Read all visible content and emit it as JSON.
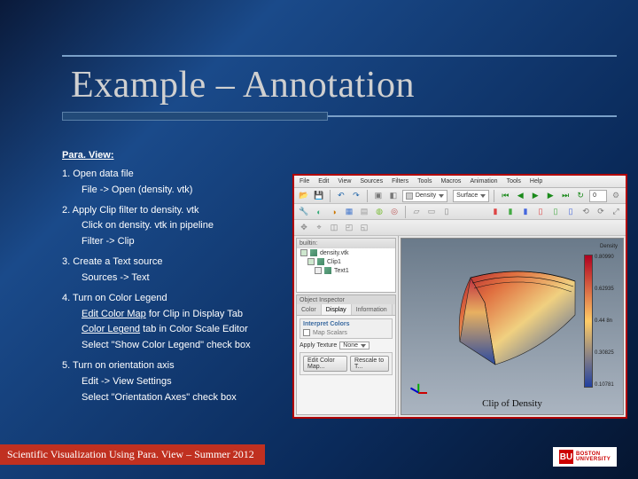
{
  "title": "Example – Annotation",
  "section_head": "Para. View:",
  "steps": [
    {
      "line": "1. Open data file",
      "subs": [
        "File -> Open (density. vtk)"
      ]
    },
    {
      "line": "2. Apply Clip filter to density. vtk",
      "subs": [
        "Click on density. vtk in pipeline",
        "Filter -> Clip"
      ]
    },
    {
      "line": "3. Create a Text source",
      "subs": [
        "Sources -> Text"
      ]
    },
    {
      "line": "4. Turn on Color Legend",
      "subs": [
        {
          "pre": "",
          "u": "Edit Color Map",
          "post": " for Clip in Display Tab"
        },
        {
          "pre": "",
          "u": "Color Legend",
          "post": " tab in Color Scale Editor"
        },
        "Select \"Show Color Legend\" check box"
      ]
    },
    {
      "line": "5. Turn on orientation axis",
      "subs": [
        "Edit -> View Settings",
        "Select \"Orientation Axes\" check box"
      ]
    }
  ],
  "footer": "Scientific Visualization Using Para. View – Summer 2012",
  "logo": {
    "initials": "BU",
    "line1": "BOSTON",
    "line2": "UNIVERSITY"
  },
  "paraview": {
    "menu": [
      "File",
      "Edit",
      "View",
      "Sources",
      "Filters",
      "Tools",
      "Macros",
      "Animation",
      "Tools",
      "Help"
    ],
    "combo_left": "Density",
    "combo_right": "Surface",
    "pipeline_header": "builtin:",
    "pipeline_items": [
      "density.vtk",
      "Clip1",
      "Text1"
    ],
    "inspector_title": "Object Inspector",
    "tabs": [
      "Color",
      "Display",
      "Information"
    ],
    "grp1_title": "Interpret Colors",
    "grp1_check": "Map Scalars",
    "apply_texture_label": "Apply Texture",
    "apply_texture_value": "None",
    "btn_edit": "Edit Color Map...",
    "btn_rescale": "Rescale to T...",
    "legend_title": "Density",
    "legend_ticks": [
      "0.80990",
      "0.62935",
      "0.44 8n",
      "0.30825",
      "0.10781"
    ],
    "caption": "Clip of Density"
  }
}
